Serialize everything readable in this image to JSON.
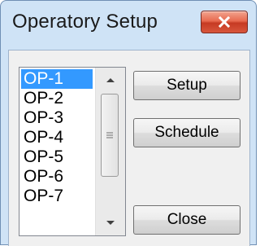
{
  "window": {
    "title": "Operatory Setup",
    "close_icon": "close-icon"
  },
  "operatory_list": {
    "items": [
      "OP-1",
      "OP-2",
      "OP-3",
      "OP-4",
      "OP-5",
      "OP-6",
      "OP-7"
    ],
    "selected": "OP-1"
  },
  "buttons": {
    "setup": "Setup",
    "schedule": "Schedule",
    "close": "Close"
  },
  "colors": {
    "title_bar": "#cfe3f6",
    "close_button": "#d8573d",
    "selection": "#3399ff"
  }
}
